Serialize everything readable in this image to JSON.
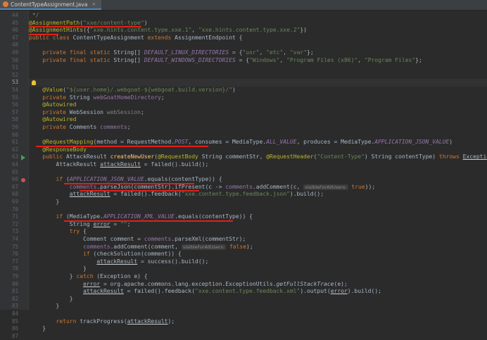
{
  "tab": {
    "title": "ContentTypeAssignment.java",
    "close": "×"
  },
  "colors": {
    "annotation": "#bbb529",
    "string": "#6a8759",
    "keyword": "#cc7832",
    "field": "#9876aa",
    "method": "#ffc66d",
    "default_text": "#a9b7c6",
    "underline_red": "#e0201a"
  },
  "gutter_icons": {
    "line53": "lightbulb-icon",
    "line64": "run-gutter-icon",
    "line66": "breakpoint-icon"
  },
  "lines": [
    {
      "n": "44",
      "t": [
        [
          "cmt",
          " */"
        ]
      ]
    },
    {
      "n": "45",
      "t": [
        [
          "annot",
          "@AssignmentPath"
        ],
        [
          "",
          "("
        ],
        [
          "str",
          "\"xxe/content-type\""
        ],
        [
          "",
          ")"
        ]
      ]
    },
    {
      "n": "46",
      "t": [
        [
          "annot",
          "@AssignmentHints"
        ],
        [
          "",
          "({"
        ],
        [
          "str",
          "\"xxe.hints.content.type.xxe.1\""
        ],
        [
          "",
          ", "
        ],
        [
          "str",
          "\"xxe.hints.content.type.xxe.2\""
        ],
        [
          "",
          "})"
        ]
      ]
    },
    {
      "n": "47",
      "t": [
        [
          "kw",
          "public class "
        ],
        [
          "",
          "ContentTypeAssignment "
        ],
        [
          "kw",
          "extends "
        ],
        [
          "",
          "AssignmentEndpoint {"
        ]
      ]
    },
    {
      "n": "48",
      "t": []
    },
    {
      "n": "49",
      "t": [
        [
          "kw",
          "    private final static "
        ],
        [
          "",
          "String[] "
        ],
        [
          "sfld",
          "DEFAULT_LINUX_DIRECTORIES"
        ],
        [
          "",
          " = {"
        ],
        [
          "str",
          "\"usr\""
        ],
        [
          "",
          ", "
        ],
        [
          "str",
          "\"etc\""
        ],
        [
          "",
          ", "
        ],
        [
          "str",
          "\"var\""
        ],
        [
          "",
          "};"
        ]
      ]
    },
    {
      "n": "50",
      "t": [
        [
          "kw",
          "    private final static "
        ],
        [
          "",
          "String[] "
        ],
        [
          "sfld",
          "DEFAULT_WINDOWS_DIRECTORIES"
        ],
        [
          "",
          " = {"
        ],
        [
          "str",
          "\"Windows\""
        ],
        [
          "",
          ", "
        ],
        [
          "str",
          "\"Program Files (x86)\""
        ],
        [
          "",
          ", "
        ],
        [
          "str",
          "\"Program Files\""
        ],
        [
          "",
          "};"
        ]
      ]
    },
    {
      "n": "51",
      "t": []
    },
    {
      "n": "52",
      "t": []
    },
    {
      "n": "53",
      "t": [],
      "cur": true
    },
    {
      "n": "54",
      "t": [
        [
          "annot",
          "    @Value"
        ],
        [
          "",
          "("
        ],
        [
          "str",
          "\"${user.home}/.webgoat-${webgoat.build.version}/\""
        ],
        [
          "",
          ")"
        ]
      ]
    },
    {
      "n": "55",
      "t": [
        [
          "kw",
          "    private "
        ],
        [
          "",
          "String "
        ],
        [
          "fld",
          "webGoatHomeDirectory"
        ],
        [
          "",
          ";"
        ]
      ]
    },
    {
      "n": "56",
      "t": [
        [
          "annot",
          "    @Autowired"
        ]
      ]
    },
    {
      "n": "57",
      "t": [
        [
          "kw",
          "    private "
        ],
        [
          "",
          "WebSession "
        ],
        [
          "unused",
          "webSession"
        ],
        [
          "",
          ";"
        ]
      ]
    },
    {
      "n": "58",
      "t": [
        [
          "annot",
          "    @Autowired"
        ]
      ]
    },
    {
      "n": "59",
      "t": [
        [
          "kw",
          "    private "
        ],
        [
          "",
          "Comments "
        ],
        [
          "fld",
          "comments"
        ],
        [
          "",
          ";"
        ]
      ]
    },
    {
      "n": "60",
      "t": []
    },
    {
      "n": "61",
      "t": [
        [
          "annot",
          "    @RequestMapping"
        ],
        [
          "",
          "(method = RequestMethod."
        ],
        [
          "sfld",
          "POST"
        ],
        [
          "",
          ", consumes = MediaType."
        ],
        [
          "sfld",
          "ALL_VALUE"
        ],
        [
          "",
          ", produces = MediaType."
        ],
        [
          "sfld",
          "APPLICATION_JSON_VALUE"
        ],
        [
          "",
          ")"
        ]
      ]
    },
    {
      "n": "62",
      "t": [
        [
          "annot",
          "    @ResponseBody"
        ]
      ]
    },
    {
      "n": "63",
      "t": [
        [
          "kw",
          "    public "
        ],
        [
          "",
          "AttackResult "
        ],
        [
          "mth",
          "createNewUser"
        ],
        [
          "",
          "("
        ],
        [
          "annot",
          "@RequestBody "
        ],
        [
          "",
          "String commentStr, "
        ],
        [
          "annot",
          "@RequestHeader"
        ],
        [
          "",
          "("
        ],
        [
          "str",
          "\"Content-Type\""
        ],
        [
          "",
          ") String contentType) "
        ],
        [
          "kw",
          "throws "
        ],
        [
          "u",
          "Exception"
        ],
        [
          "",
          " {"
        ]
      ]
    },
    {
      "n": "64",
      "t": [
        [
          "",
          "        AttackResult "
        ],
        [
          "u",
          "attackResult"
        ],
        [
          "",
          " = failed().build();"
        ]
      ]
    },
    {
      "n": "65",
      "t": []
    },
    {
      "n": "66",
      "t": [
        [
          "kw",
          "        if "
        ],
        [
          "",
          "("
        ],
        [
          "sfld",
          "APPLICATION_JSON_VALUE"
        ],
        [
          "",
          ".equals(contentType)) {"
        ]
      ]
    },
    {
      "n": "67",
      "t": [
        [
          "",
          "            "
        ],
        [
          "fld",
          "comments"
        ],
        [
          "",
          ".parseJson(commentStr).ifPresent(c -> "
        ],
        [
          "fld",
          "comments"
        ],
        [
          "",
          ".addComment(c, "
        ],
        [
          "hint",
          "visibleForAllUsers:"
        ],
        [
          "kw",
          " true"
        ],
        [
          "",
          "));"
        ]
      ]
    },
    {
      "n": "68",
      "t": [
        [
          "",
          "            "
        ],
        [
          "u",
          "attackResult"
        ],
        [
          "",
          " = failed().feedback("
        ],
        [
          "str",
          "\"xxe.content.type.feedback.json\""
        ],
        [
          "",
          ").build();"
        ]
      ]
    },
    {
      "n": "69",
      "t": [
        [
          "",
          "        }"
        ]
      ]
    },
    {
      "n": "70",
      "t": []
    },
    {
      "n": "71",
      "t": [
        [
          "kw",
          "        if "
        ],
        [
          "",
          "(MediaType."
        ],
        [
          "sfld",
          "APPLICATION_XML_VALUE"
        ],
        [
          "",
          ".equals(contentType)) {"
        ]
      ]
    },
    {
      "n": "72",
      "t": [
        [
          "",
          "            String "
        ],
        [
          "u",
          "error"
        ],
        [
          "",
          " = "
        ],
        [
          "str",
          "\"\""
        ],
        [
          "",
          ";"
        ]
      ]
    },
    {
      "n": "73",
      "t": [
        [
          "kw",
          "            try "
        ],
        [
          "",
          "{"
        ]
      ]
    },
    {
      "n": "74",
      "t": [
        [
          "",
          "                Comment comment = "
        ],
        [
          "fld",
          "comments"
        ],
        [
          "",
          ".parseXml(commentStr);"
        ]
      ]
    },
    {
      "n": "75",
      "t": [
        [
          "",
          "                "
        ],
        [
          "fld",
          "comments"
        ],
        [
          "",
          ".addComment(comment, "
        ],
        [
          "hint",
          "visibleForAllUsers:"
        ],
        [
          "kw",
          " false"
        ],
        [
          "",
          ");"
        ]
      ]
    },
    {
      "n": "76",
      "t": [
        [
          "kw",
          "                if "
        ],
        [
          "",
          "(checkSolution(comment)) {"
        ]
      ]
    },
    {
      "n": "77",
      "t": [
        [
          "",
          "                    "
        ],
        [
          "u",
          "attackResult"
        ],
        [
          "",
          " = success().build();"
        ]
      ]
    },
    {
      "n": "78",
      "t": [
        [
          "",
          "                }"
        ]
      ]
    },
    {
      "n": "79",
      "t": [
        [
          "",
          "            } "
        ],
        [
          "kw",
          "catch "
        ],
        [
          "",
          "(Exception e) {"
        ]
      ]
    },
    {
      "n": "80",
      "t": [
        [
          "",
          "                "
        ],
        [
          "u",
          "error"
        ],
        [
          "",
          " = org.apache.commons.lang.exception.ExceptionUtils."
        ],
        [
          "it",
          "getFullStackTrace"
        ],
        [
          "",
          "(e);"
        ]
      ]
    },
    {
      "n": "81",
      "t": [
        [
          "",
          "                "
        ],
        [
          "u",
          "attackResult"
        ],
        [
          "",
          " = failed().feedback("
        ],
        [
          "str",
          "\"xxe.content.type.feedback.xml\""
        ],
        [
          "",
          ").output("
        ],
        [
          "u",
          "error"
        ],
        [
          "",
          ").build();"
        ]
      ]
    },
    {
      "n": "82",
      "t": [
        [
          "",
          "            }"
        ]
      ]
    },
    {
      "n": "83",
      "t": [
        [
          "",
          "        }"
        ]
      ]
    },
    {
      "n": "84",
      "t": []
    },
    {
      "n": "85",
      "t": [
        [
          "kw",
          "        return "
        ],
        [
          "",
          "trackProgress("
        ],
        [
          "u",
          "attackResult"
        ],
        [
          "",
          ");"
        ]
      ]
    },
    {
      "n": "86",
      "t": [
        [
          "",
          "    }"
        ]
      ]
    },
    {
      "n": "87",
      "t": []
    }
  ]
}
